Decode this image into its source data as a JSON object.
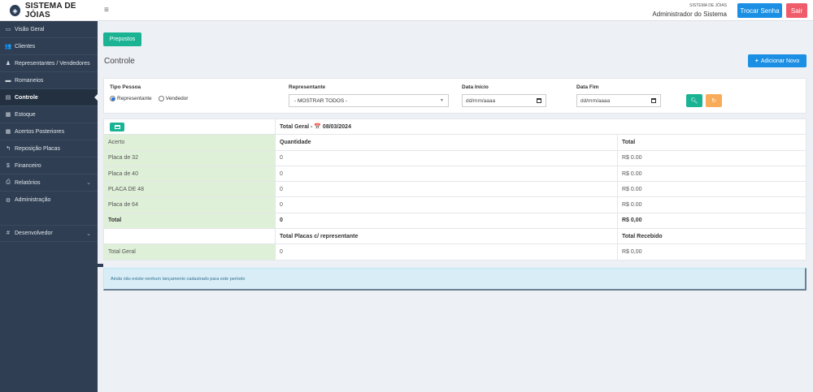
{
  "header": {
    "brand": "SISTEMA DE JÓIAS",
    "system_small": "SISTEMA DE JÓIAS",
    "user_name": "Administrador do Sistema",
    "change_password": "Trocar Senha",
    "logout": "Sair"
  },
  "sidebar": {
    "items": [
      {
        "label": "Visão Geral",
        "icon": "monitor-icon",
        "glyph": "▭"
      },
      {
        "label": "Clientes",
        "icon": "users-icon",
        "glyph": "👥"
      },
      {
        "label": "Representantes / Vendedores",
        "icon": "user-secret-icon",
        "glyph": "♟"
      },
      {
        "label": "Romaneios",
        "icon": "briefcase-icon",
        "glyph": "▬"
      },
      {
        "label": "Controle",
        "icon": "list-alt-icon",
        "glyph": "▤"
      },
      {
        "label": "Estoque",
        "icon": "grid-icon",
        "glyph": "▦"
      },
      {
        "label": "Acertos Posteriores",
        "icon": "calendar-icon",
        "glyph": "▦"
      },
      {
        "label": "Reposição Placas",
        "icon": "reply-icon",
        "glyph": "↰"
      },
      {
        "label": "Financeiro",
        "icon": "dollar-icon",
        "glyph": "$"
      },
      {
        "label": "Relatórios",
        "icon": "print-icon",
        "glyph": "⎙"
      },
      {
        "label": "Administração",
        "icon": "gear-icon",
        "glyph": "⚙"
      },
      {
        "label": "Desenvolvedor",
        "icon": "hashtag-icon",
        "glyph": "#"
      }
    ]
  },
  "main": {
    "prepostos_button": "Prepostos",
    "title": "Controle",
    "add_button": "Adicionar Novo",
    "add_glyph": "+"
  },
  "filters": {
    "tipo_pessoa_label": "Tipo Pessoa",
    "option_representante": "Representante",
    "option_vendedor": "Vendedor",
    "representante_label": "Representante",
    "representante_value": "- MOSTRAR TODOS -",
    "data_inicio_label": "Data Início",
    "data_inicio_placeholder": "dd/mm/aaaa",
    "data_fim_label": "Data Fim",
    "data_fim_placeholder": "dd/mm/aaaa"
  },
  "table": {
    "total_geral_header": "Total Geral - 📅 08/03/2024",
    "header_row": [
      "Acerto",
      "Quantidade",
      "Total"
    ],
    "rows": [
      [
        "Placa de 32",
        "0",
        "R$ 0.00"
      ],
      [
        "Placa de 40",
        "0",
        "R$ 0.00"
      ],
      [
        "PLACA DE 48",
        "0",
        "R$ 0.00"
      ],
      [
        "Placa de 64",
        "0",
        "R$ 0.00"
      ]
    ],
    "total_row": [
      "Total",
      "0",
      "R$ 0,00"
    ],
    "summary_headers": [
      "",
      "Total Placas c/ representante",
      "Total Recebido"
    ],
    "summary_row": [
      "Total Geral",
      "0",
      "R$ 0,00"
    ]
  },
  "alert": "Ainda não existe nenhum lançamento cadastrado para este período",
  "colors": {
    "sidebar_bg": "#2f3e52",
    "primary": "#1a8fe3",
    "success": "#1ab394",
    "warning": "#f8ac59",
    "danger": "#f05d6a"
  }
}
